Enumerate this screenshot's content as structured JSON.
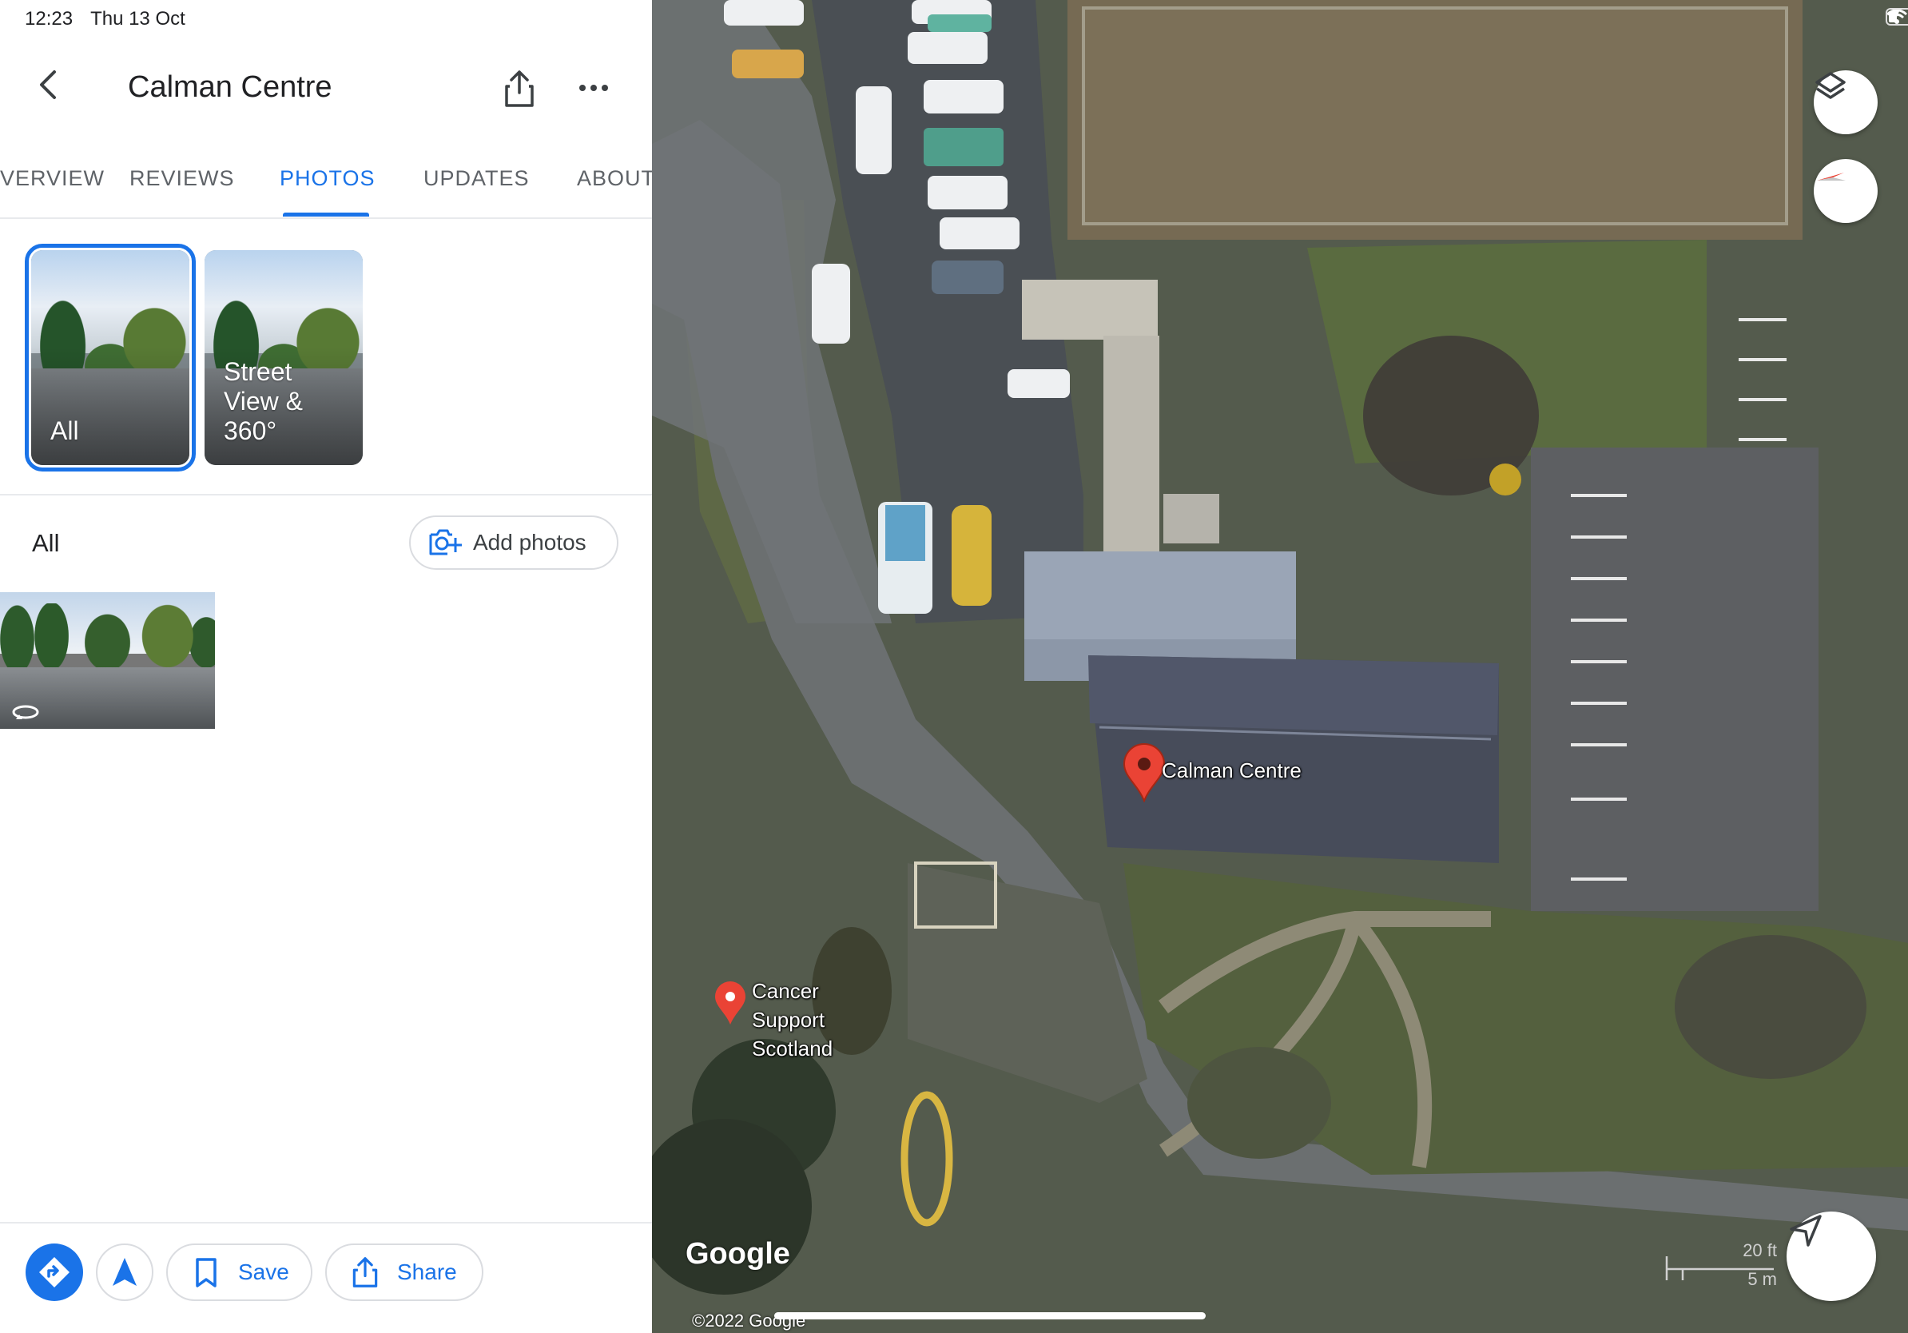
{
  "status_bar": {
    "time": "12:23",
    "date": "Thu 13 Oct"
  },
  "header": {
    "title": "Calman Centre"
  },
  "tabs": [
    {
      "label": "OVERVIEW",
      "active": false
    },
    {
      "label": "REVIEWS",
      "active": false
    },
    {
      "label": "PHOTOS",
      "active": true
    },
    {
      "label": "UPDATES",
      "active": false
    },
    {
      "label": "ABOUT",
      "active": false
    }
  ],
  "photo_categories": [
    {
      "label": "All",
      "selected": true
    },
    {
      "label": "Street\nView &\n360°",
      "selected": false
    }
  ],
  "section": {
    "title": "All",
    "add_photos_label": "Add photos"
  },
  "bottom_actions": {
    "save_label": "Save",
    "share_label": "Share"
  },
  "map": {
    "places": [
      {
        "name": "Calman Centre",
        "selected": true
      },
      {
        "name": "Cancer Support\nScotland",
        "selected": false
      }
    ],
    "attribution": "Google",
    "copyright": "©2022 Google",
    "scale": {
      "imperial": "20 ft",
      "metric": "5 m"
    }
  },
  "colors": {
    "accent": "#1a73e8",
    "pin": "#ea4335"
  }
}
